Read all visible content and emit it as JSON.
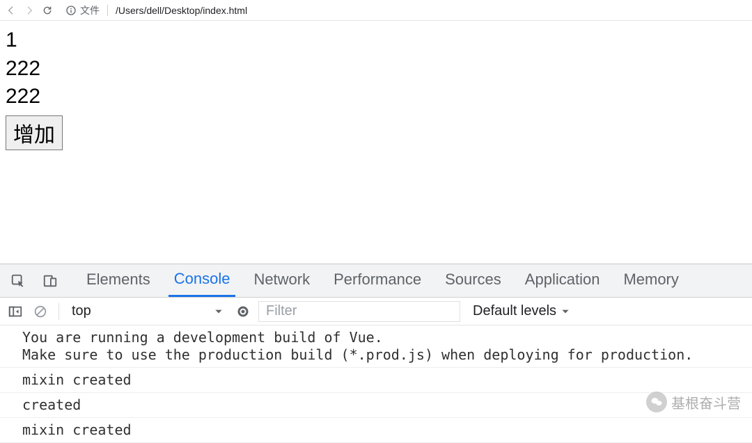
{
  "browser": {
    "protocol_label": "文件",
    "url_path": "/Users/dell/Desktop/index.html"
  },
  "page": {
    "line1": "1",
    "line2": "222",
    "line3": "222",
    "button_label": "增加"
  },
  "devtools": {
    "tabs": {
      "elements": "Elements",
      "console": "Console",
      "network": "Network",
      "performance": "Performance",
      "sources": "Sources",
      "application": "Application",
      "memory": "Memory"
    },
    "toolbar": {
      "context": "top",
      "filter_placeholder": "Filter",
      "levels_label": "Default levels"
    },
    "messages": [
      "You are running a development build of Vue.\nMake sure to use the production build (*.prod.js) when deploying for production.",
      "mixin created",
      "created",
      "mixin created"
    ]
  },
  "watermark": {
    "text": "基根奋斗营"
  }
}
